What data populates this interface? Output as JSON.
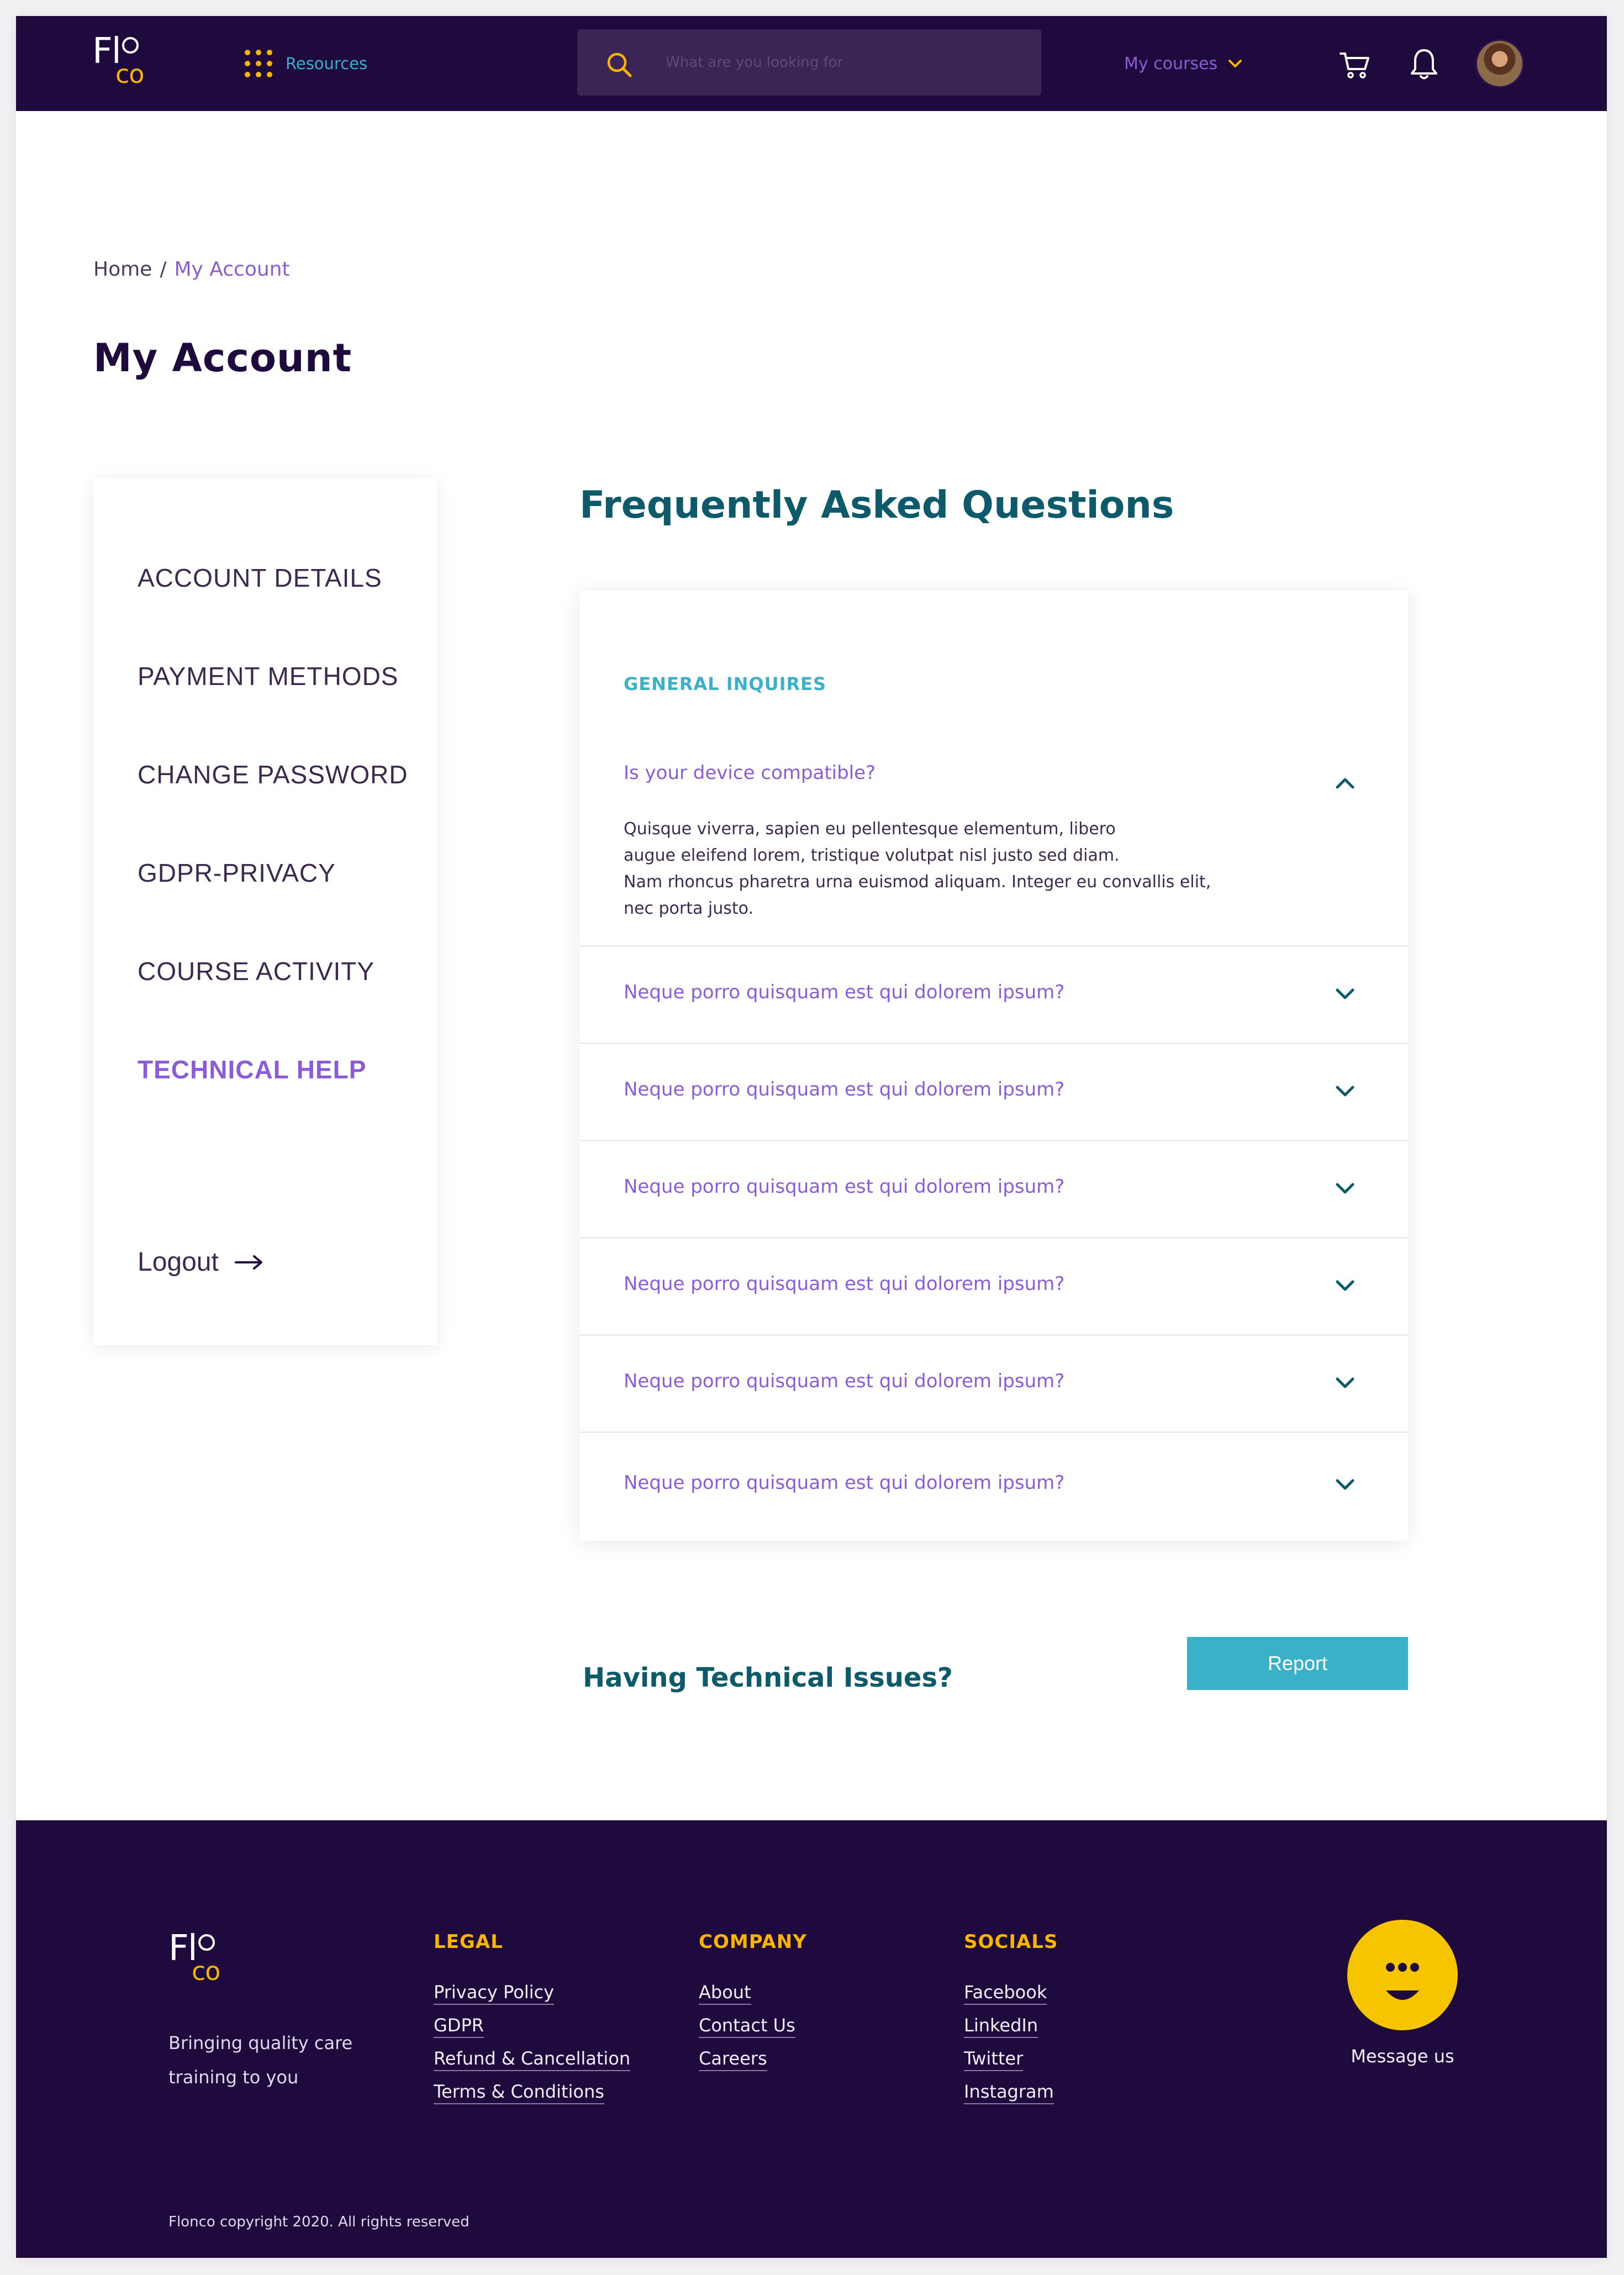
{
  "nav": {
    "logo_top": "Fl",
    "logo_bottom": "co",
    "resources_label": "Resources",
    "search_placeholder": "What are you looking for",
    "search_value": "",
    "courses_label": "My courses"
  },
  "breadcrumb": {
    "home": "Home",
    "separator": "/",
    "current": "My Account"
  },
  "page_title": "My Account",
  "sidebar": {
    "items": [
      {
        "label": "ACCOUNT DETAILS",
        "active": false
      },
      {
        "label": "PAYMENT METHODS",
        "active": false
      },
      {
        "label": "CHANGE PASSWORD",
        "active": false
      },
      {
        "label": "GDPR-PRIVACY",
        "active": false
      },
      {
        "label": "COURSE ACTIVITY",
        "active": false
      },
      {
        "label": "TECHNICAL HELP",
        "active": true
      }
    ],
    "logout_label": "Logout"
  },
  "faq": {
    "title": "Frequently Asked Questions",
    "category": "GENERAL INQUIRES",
    "open_question": "Is your device compatible?",
    "open_answer_lines": [
      "Quisque viverra, sapien eu pellentesque elementum, libero",
      "augue eleifend lorem, tristique volutpat nisl justo sed diam.",
      "Nam rhoncus pharetra urna euismod aliquam. Integer eu convallis elit,",
      "nec porta justo."
    ],
    "questions": [
      "Neque porro quisquam est qui dolorem ipsum?",
      "Neque porro quisquam est qui dolorem ipsum?",
      "Neque porro quisquam est qui dolorem ipsum?",
      "Neque porro quisquam est qui dolorem ipsum?",
      "Neque porro quisquam est qui dolorem ipsum?",
      "Neque porro quisquam est qui dolorem ipsum?"
    ]
  },
  "tech_issues": {
    "heading": "Having Technical Issues?",
    "button_label": "Report"
  },
  "footer": {
    "tagline_line1": "Bringing quality care",
    "tagline_line2": "training to you",
    "columns": [
      {
        "heading": "LEGAL",
        "links": [
          "Privacy Policy",
          "GDPR",
          "Refund & Cancellation",
          "Terms & Conditions"
        ]
      },
      {
        "heading": "COMPANY",
        "links": [
          "About",
          "Contact Us",
          "Careers"
        ]
      },
      {
        "heading": "SOCIALS",
        "links": [
          "Facebook",
          "LinkedIn",
          "Twitter",
          "Instagram"
        ]
      }
    ],
    "message_label": "Message us",
    "copyright": "Flonco copyright 2020. All rights reserved"
  },
  "colors": {
    "nav_bg": "#1e0a3c",
    "accent_purple": "#8a5cd6",
    "accent_teal": "#0d5a6b",
    "accent_cyan": "#3bb0c9",
    "accent_yellow": "#f7b500"
  },
  "icons": [
    "grid-dots-icon",
    "search-icon",
    "chevron-down-icon",
    "cart-icon",
    "bell-icon",
    "chevron-up-icon",
    "arrow-right-icon",
    "chat-face-icon"
  ]
}
